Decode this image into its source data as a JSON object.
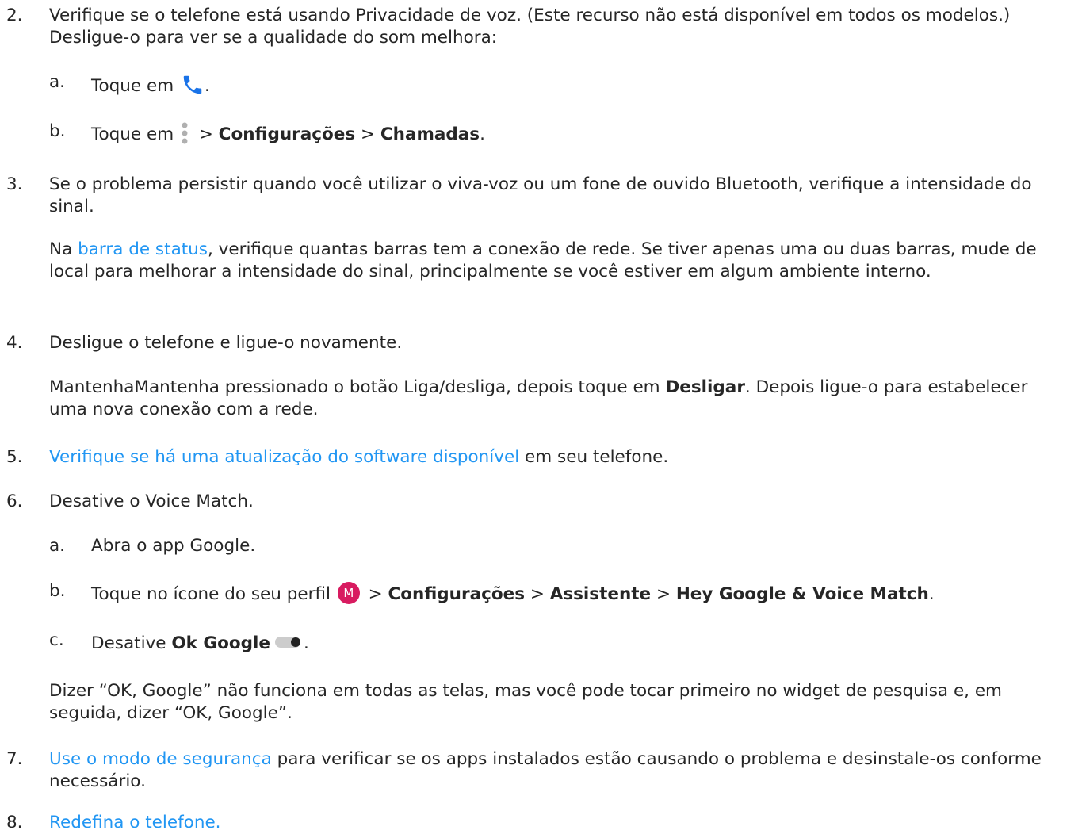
{
  "steps": [
    {
      "num": "2.",
      "text": "Verifique se o telefone está usando Privacidade de voz. (Este recurso não está disponível em todos os modelos.) Desligue-o para ver se a qualidade do som melhora:"
    },
    {
      "num": "3.",
      "text": "Se o problema persistir quando você utilizar o viva-voz ou um fone de ouvido Bluetooth, verifique a intensidade do sinal."
    },
    {
      "num": "4.",
      "text": "Desligue o telefone e ligue-o novamente."
    },
    {
      "num": "5.",
      "link": "Verifique se há uma atualização do software disponível",
      "rest": " em seu telefone."
    },
    {
      "num": "6.",
      "text": "Desative o Voice Match."
    },
    {
      "num": "7.",
      "link": "Use o modo de segurança",
      "rest": " para verificar se os apps instalados estão causando o problema e desinstale-os conforme necessário."
    },
    {
      "num": "8.",
      "link": "Redefina o telefone."
    }
  ],
  "step2_sub": {
    "a": {
      "label": "a.",
      "text": "Toque em ",
      "end": "."
    },
    "b": {
      "label": "b.",
      "text": "Toque em ",
      "sep1": " > ",
      "bold1": "Configurações",
      "sep2": " > ",
      "bold2": "Chamadas",
      "end": "."
    }
  },
  "step3_para": {
    "pre": "Na ",
    "link": "barra de status",
    "post": ", verifique quantas barras tem a conexão de rede. Se tiver apenas uma ou duas barras, mude de local para melhorar a intensidade do sinal, principalmente se você estiver em algum ambiente interno."
  },
  "step4_para": {
    "pre": "MantenhaMantenha pressionado o botão Liga/desliga, depois toque em ",
    "bold": "Desligar",
    "post": ". Depois ligue-o para estabelecer uma nova conexão com a rede."
  },
  "step6_sub": {
    "a": {
      "label": "a.",
      "text": "Abra o app Google."
    },
    "b": {
      "label": "b.",
      "text": "Toque no ícone do seu perfil ",
      "avatar_letter": "M",
      "sep1": " > ",
      "bold1": "Configurações",
      "sep2": " > ",
      "bold2": "Assistente",
      "sep3": " > ",
      "bold3": "Hey Google & Voice Match",
      "end": "."
    },
    "c": {
      "label": "c.",
      "text": "Desative ",
      "bold": "Ok Google",
      "end": "."
    }
  },
  "step6_para": {
    "text": "Dizer “OK, Google” não funciona em todas as telas, mas você pode tocar primeiro no widget de pesquisa e, em seguida, dizer “OK, Google”."
  },
  "icons": {
    "phone": "phone-icon",
    "more": "more-vert-icon",
    "avatar": "avatar-icon",
    "toggle": "toggle-off-icon"
  },
  "colors": {
    "text": "#262626",
    "link": "#2196f3",
    "phone_icon": "#1a73e8",
    "avatar": "#d81b60",
    "toggle_track": "#cccccc",
    "toggle_thumb": "#222222",
    "dots": "#b0b0b0"
  }
}
